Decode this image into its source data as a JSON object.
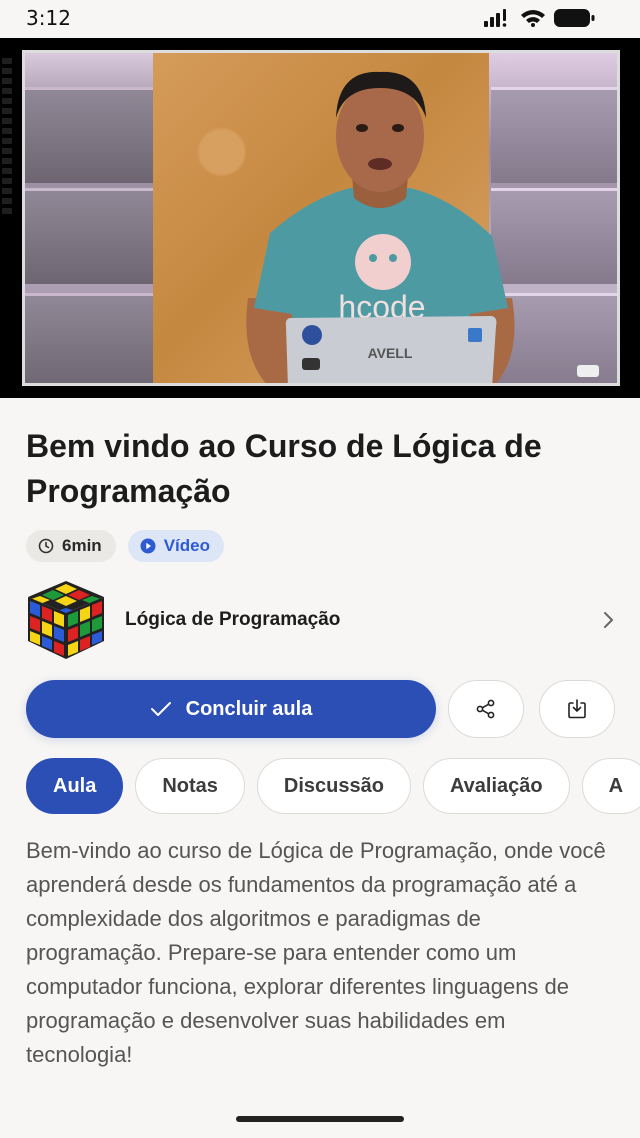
{
  "status_bar": {
    "time": "3:12"
  },
  "lesson": {
    "title": "Bem vindo ao Curso de Lógica de Programação",
    "duration": "6min",
    "type": "Vídeo",
    "video_shirt_text": "hcode",
    "video_laptop_text": "AVELL"
  },
  "course": {
    "name": "Lógica de Programação"
  },
  "actions": {
    "complete_label": "Concluir aula"
  },
  "tabs": [
    {
      "label": "Aula",
      "active": true
    },
    {
      "label": "Notas",
      "active": false
    },
    {
      "label": "Discussão",
      "active": false
    },
    {
      "label": "Avaliação",
      "active": false
    },
    {
      "label": "A",
      "active": false
    }
  ],
  "description": "Bem-vindo ao curso de Lógica de Programação, onde você aprenderá desde os fundamentos da programação até a complexidade dos algoritmos e paradigmas de programação. Prepare-se para entender como um computador funciona, explorar diferentes linguagens de programação e desenvolver suas habilidades em tecnologia!",
  "colors": {
    "primary": "#2c4fb6",
    "chip_type_bg": "#dde6f7",
    "background": "#f7f6f4"
  }
}
